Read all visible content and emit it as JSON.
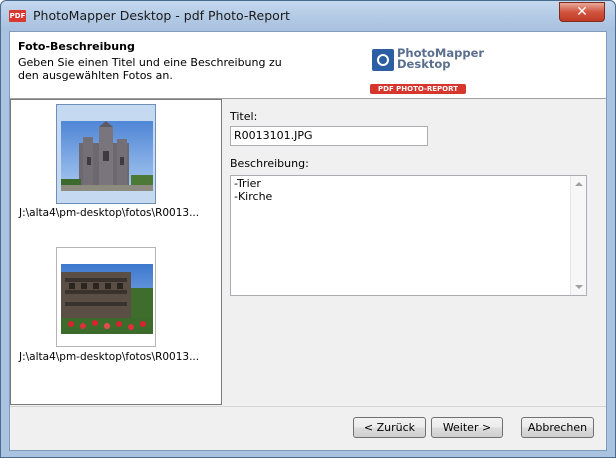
{
  "window": {
    "app_icon": "PDF",
    "title": "PhotoMapper Desktop - pdf Photo-Report",
    "close_glyph": "✕"
  },
  "header": {
    "title": "Foto-Beschreibung",
    "description": "Geben Sie einen Titel und eine Beschreibung zu den ausgewählten Fotos an.",
    "logo": {
      "line1": "PhotoMapper",
      "line2": "Desktop",
      "badge": "PDF PHOTO-REPORT"
    }
  },
  "photos": [
    {
      "caption": "J:\\alta4\\pm-desktop\\fotos\\R0013...",
      "selected": true,
      "subject": "church-photo"
    },
    {
      "caption": "J:\\alta4\\pm-desktop\\fotos\\R0013...",
      "selected": false,
      "subject": "roman-gate-photo"
    }
  ],
  "form": {
    "title_label": "Titel:",
    "title_value": "R0013101.JPG",
    "description_label": "Beschreibung:",
    "description_lines": [
      "-Trier",
      "-Kirche"
    ]
  },
  "buttons": {
    "back": "< Zurück",
    "next": "Weiter >",
    "cancel": "Abbrechen"
  },
  "colors": {
    "selection": "#c5d9f1",
    "window_frame": "#a9c3e0",
    "close_button": "#c94a34",
    "badge_red": "#d6362c"
  }
}
